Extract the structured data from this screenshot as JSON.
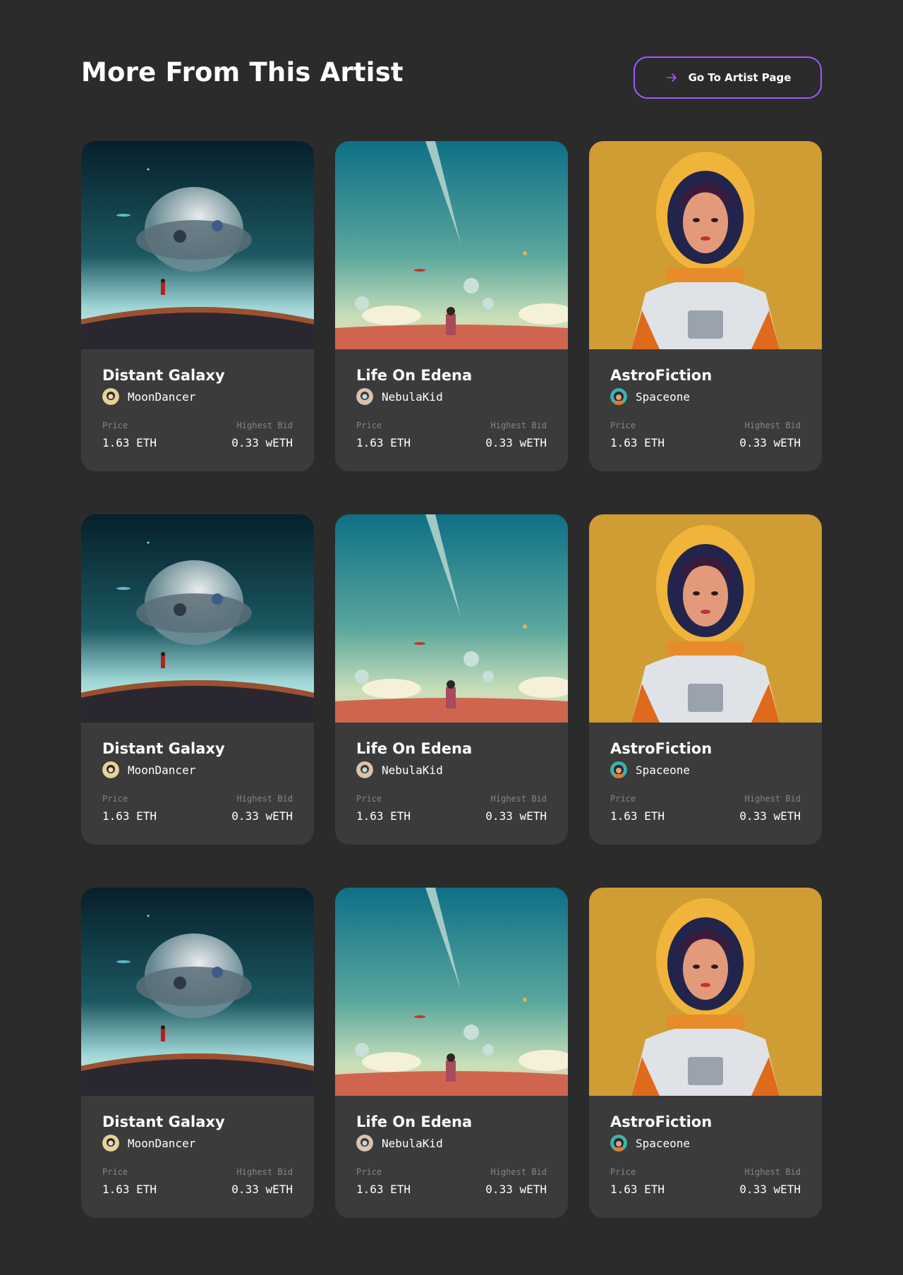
{
  "section": {
    "title": "More From This Artist",
    "button_label": "Go To Artist Page",
    "button_icon": "arrow-right-icon",
    "accent": "#A259FF"
  },
  "cards": [
    {
      "name": "Distant Galaxy",
      "artist": "MoonDancer",
      "price_label": "Price",
      "price": "1.63 ETH",
      "bid_label": "Highest Bid",
      "bid": "0.33 wETH"
    },
    {
      "name": "Life On Edena",
      "artist": "NebulaKid",
      "price_label": "Price",
      "price": "1.63 ETH",
      "bid_label": "Highest Bid",
      "bid": "0.33 wETH"
    },
    {
      "name": "AstroFiction",
      "artist": "Spaceone",
      "price_label": "Price",
      "price": "1.63 ETH",
      "bid_label": "Highest Bid",
      "bid": "0.33 wETH"
    },
    {
      "name": "Distant Galaxy",
      "artist": "MoonDancer",
      "price_label": "Price",
      "price": "1.63 ETH",
      "bid_label": "Highest Bid",
      "bid": "0.33 wETH"
    },
    {
      "name": "Life On Edena",
      "artist": "NebulaKid",
      "price_label": "Price",
      "price": "1.63 ETH",
      "bid_label": "Highest Bid",
      "bid": "0.33 wETH"
    },
    {
      "name": "AstroFiction",
      "artist": "Spaceone",
      "price_label": "Price",
      "price": "1.63 ETH",
      "bid_label": "Highest Bid",
      "bid": "0.33 wETH"
    },
    {
      "name": "Distant Galaxy",
      "artist": "MoonDancer",
      "price_label": "Price",
      "price": "1.63 ETH",
      "bid_label": "Highest Bid",
      "bid": "0.33 wETH"
    },
    {
      "name": "Life On Edena",
      "artist": "NebulaKid",
      "price_label": "Price",
      "price": "1.63 ETH",
      "bid_label": "Highest Bid",
      "bid": "0.33 wETH"
    },
    {
      "name": "AstroFiction",
      "artist": "Spaceone",
      "price_label": "Price",
      "price": "1.63 ETH",
      "bid_label": "Highest Bid",
      "bid": "0.33 wETH"
    }
  ]
}
